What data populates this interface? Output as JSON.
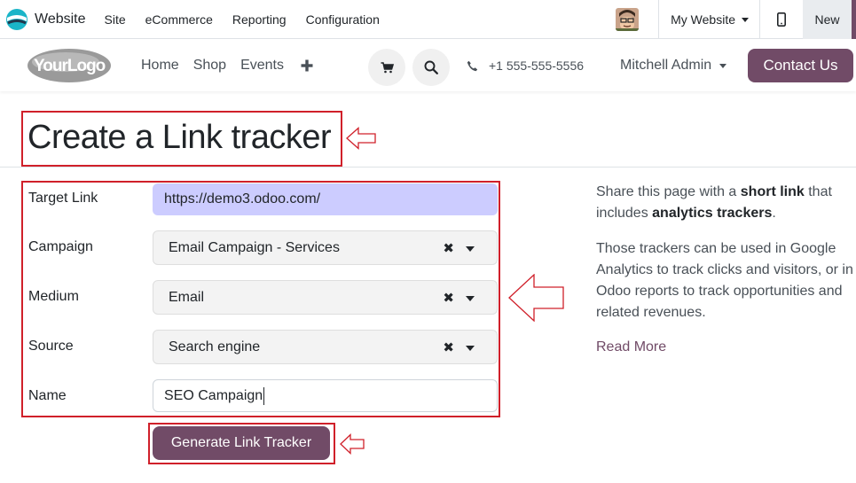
{
  "adminbar": {
    "app_name": "Website",
    "menu": [
      "Site",
      "eCommerce",
      "Reporting",
      "Configuration"
    ],
    "website_selector": "My Website",
    "new_label": "New"
  },
  "site_header": {
    "logo_text": "YourLogo",
    "nav": [
      "Home",
      "Shop",
      "Events"
    ],
    "phone": "+1 555-555-5556",
    "user": "Mitchell Admin",
    "contact_label": "Contact Us"
  },
  "page": {
    "title": "Create a Link tracker"
  },
  "form": {
    "target_link": {
      "label": "Target Link",
      "value": "https://demo3.odoo.com/"
    },
    "campaign": {
      "label": "Campaign",
      "value": "Email Campaign - Services"
    },
    "medium": {
      "label": "Medium",
      "value": "Email"
    },
    "source": {
      "label": "Source",
      "value": "Search engine"
    },
    "name": {
      "label": "Name",
      "value": "SEO Campaign"
    },
    "submit_label": "Generate Link Tracker"
  },
  "sidebar": {
    "p1_pre": "Share this page with a ",
    "p1_bold1": "short link",
    "p1_mid": " that includes ",
    "p1_bold2": "analytics trackers",
    "p1_post": ".",
    "p2": "Those trackers can be used in Google Analytics to track clicks and visitors, or in Odoo reports to track opportunities and related revenues.",
    "read_more": "Read More"
  },
  "colors": {
    "brand": "#714b67",
    "highlight_border": "#d0202a",
    "url_field_bg": "#ccccff"
  }
}
